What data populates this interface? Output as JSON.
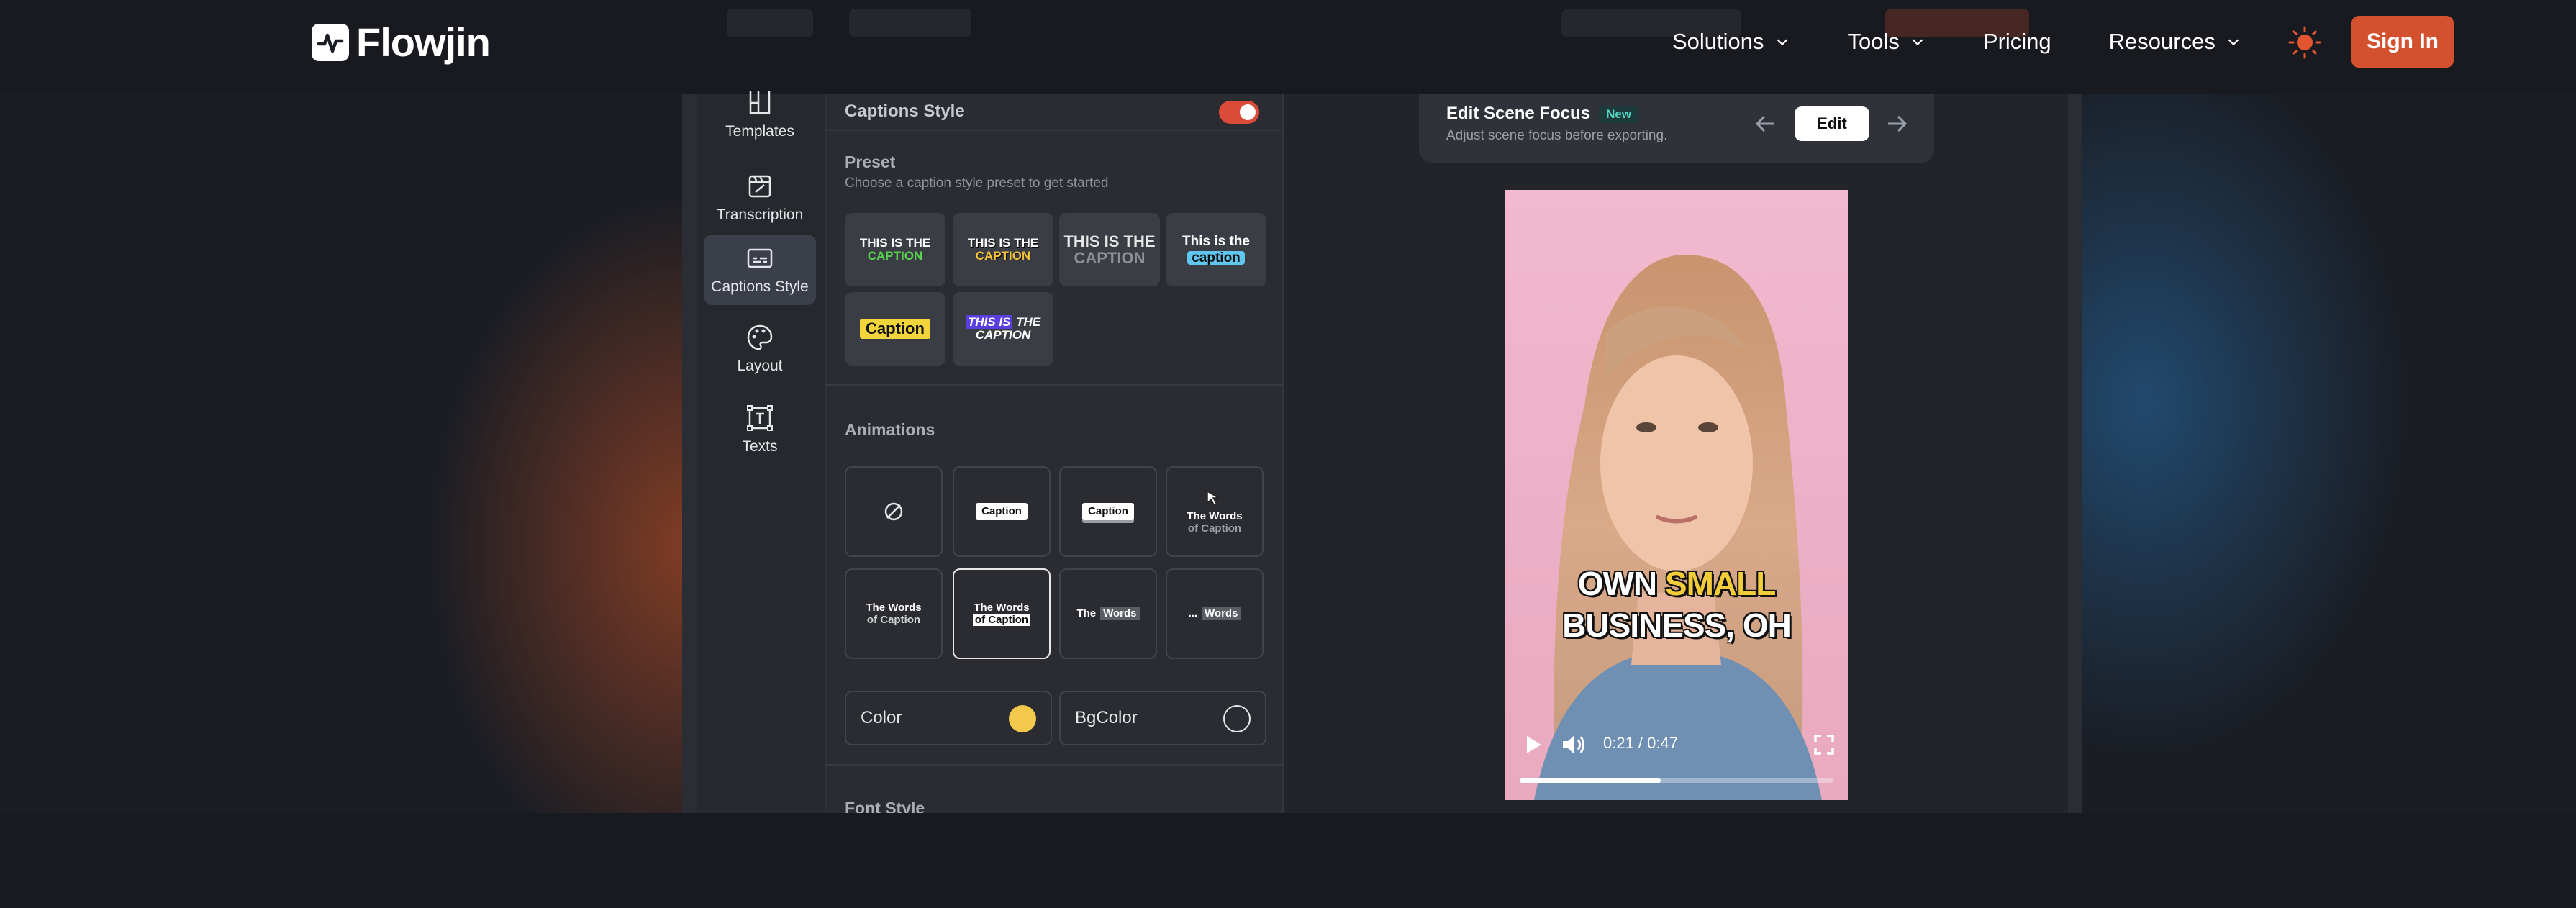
{
  "header": {
    "logo_text": "Flowjin",
    "nav": [
      {
        "label": "Solutions",
        "has_dropdown": true
      },
      {
        "label": "Tools",
        "has_dropdown": true
      },
      {
        "label": "Pricing",
        "has_dropdown": false
      },
      {
        "label": "Resources",
        "has_dropdown": true
      }
    ],
    "signin_label": "Sign In",
    "accent_color": "#d4512f"
  },
  "sidebar": {
    "items": [
      {
        "label": "Templates",
        "icon": "templates-icon"
      },
      {
        "label": "Transcription",
        "icon": "transcription-icon"
      },
      {
        "label": "Captions Style",
        "icon": "captions-icon",
        "active": true
      },
      {
        "label": "Layout",
        "icon": "palette-icon"
      },
      {
        "label": "Texts",
        "icon": "text-box-icon"
      }
    ]
  },
  "panel": {
    "title": "Captions Style",
    "toggle_on": true,
    "preset": {
      "title": "Preset",
      "subtitle": "Choose a caption style preset to get started",
      "items": [
        {
          "line1": "THIS IS THE",
          "line2": "CAPTION"
        },
        {
          "line1": "THIS IS THE",
          "line2": "CAPTION"
        },
        {
          "line1": "THIS IS THE",
          "line2": "CAPTION"
        },
        {
          "line1": "This is the",
          "line2": "caption"
        },
        {
          "line1": "Caption",
          "line2": ""
        },
        {
          "line1": "THIS IS THE",
          "line2": "CAPTION"
        }
      ]
    },
    "animations": {
      "title": "Animations",
      "items": [
        {
          "label": "",
          "icon": "none-icon"
        },
        {
          "label": "Caption"
        },
        {
          "label": "Caption"
        },
        {
          "label": "The Words of Caption",
          "word1": "The Words",
          "word2": "of Caption"
        },
        {
          "label": "The Words of Caption",
          "word1": "The Words",
          "word2": "of Caption"
        },
        {
          "label": "The Words of Caption",
          "word1": "The Words",
          "word2": "of Caption",
          "selected": true
        },
        {
          "label": "The Words",
          "word1": "The",
          "word2": "Words"
        },
        {
          "label": "... Words",
          "word1": "...",
          "word2": "Words"
        }
      ]
    },
    "color_label": "Color",
    "color_value": "#f2c94c",
    "bgcolor_label": "BgColor",
    "font_style_title": "Font Style"
  },
  "scene": {
    "title": "Edit Scene Focus",
    "badge": "New",
    "subtitle": "Adjust scene focus before exporting.",
    "edit_label": "Edit"
  },
  "video": {
    "caption_line1_a": "OWN ",
    "caption_line1_b": "SMALL",
    "caption_line2": "BUSINESS, OH",
    "time": "0:21 / 0:47",
    "progress": 0.45
  }
}
